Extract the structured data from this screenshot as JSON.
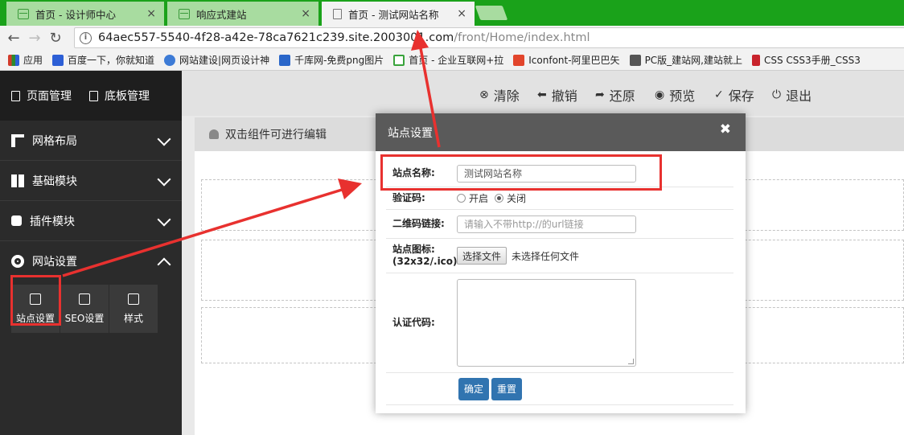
{
  "browser": {
    "tabs": [
      {
        "label": "首页 - 设计师中心",
        "close": "×",
        "active": false
      },
      {
        "label": "响应式建站",
        "close": "×",
        "active": false
      },
      {
        "label": "首页 - 测试网站名称",
        "close": "×",
        "active": true
      }
    ],
    "url": {
      "host": "64aec557-5540-4f28-a42e-78ca7621c239.site.2003001.com",
      "path": "/front/Home/index.html"
    },
    "bookmarks": [
      {
        "label": "应用",
        "color": "#d23a2a"
      },
      {
        "label": "百度一下，你就知道",
        "color": "#2d5fd6"
      },
      {
        "label": "网站建设|网页设计神",
        "color": "#3d7bd6"
      },
      {
        "label": "千库网-免费png图片",
        "color": "#2a66c9"
      },
      {
        "label": "首页 - 企业互联网+拉",
        "color": "#39a33b"
      },
      {
        "label": "Iconfont-阿里巴巴矢",
        "color": "#e2452c"
      },
      {
        "label": "PC版_建站网,建站就上",
        "color": "#555555"
      },
      {
        "label": "CSS CSS3手册_CSS3",
        "color": "#c8232c"
      }
    ]
  },
  "sidebar": {
    "top": [
      "页面管理",
      "底板管理"
    ],
    "sections": [
      {
        "label": "网格布局",
        "expanded": false
      },
      {
        "label": "基础模块",
        "expanded": false
      },
      {
        "label": "插件模块",
        "expanded": false
      },
      {
        "label": "网站设置",
        "expanded": true
      }
    ],
    "sub_items": [
      "站点设置",
      "SEO设置",
      "样式"
    ]
  },
  "actions": [
    {
      "label": "清除",
      "icon": "clear-icon",
      "glyph": "⊗"
    },
    {
      "label": "撤销",
      "icon": "undo-icon",
      "glyph": "⬅"
    },
    {
      "label": "还原",
      "icon": "redo-icon",
      "glyph": "➦"
    },
    {
      "label": "预览",
      "icon": "preview-icon",
      "glyph": "◉"
    },
    {
      "label": "保存",
      "icon": "save-icon",
      "glyph": "✓"
    },
    {
      "label": "退出",
      "icon": "exit-icon",
      "glyph": "⏻"
    }
  ],
  "editor": {
    "hint": "双击组件可进行编辑"
  },
  "modal": {
    "title": "站点设置",
    "close": "✖",
    "site_name_label": "站点名称:",
    "site_name_value": "测试网站名称",
    "captcha_label": "验证码:",
    "captcha_on": "开启",
    "captcha_off": "关闭",
    "captcha_selected": "关闭",
    "qr_label": "二维码链接:",
    "qr_placeholder": "请输入不带http://的url链接",
    "icon_label_1": "站点图标:",
    "icon_label_2": "(32x32/.ico)",
    "file_button": "选择文件",
    "file_status": "未选择任何文件",
    "cert_label": "认证代码:",
    "confirm": "确定",
    "reset": "重置"
  },
  "colors": {
    "tab_green": "#1aa21a",
    "accent_blue": "#3174b0",
    "annotation_red": "#e8312f",
    "panel_dark": "#2b2b2b"
  }
}
